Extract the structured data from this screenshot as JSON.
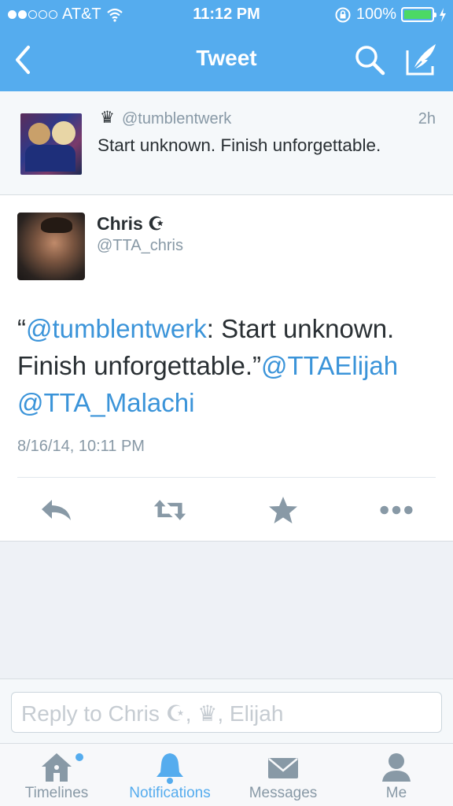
{
  "status_bar": {
    "carrier": "AT&T",
    "time": "11:12 PM",
    "battery": "100%",
    "signal_bars_filled": 2,
    "signal_bars_total": 5
  },
  "nav": {
    "title": "Tweet",
    "back_icon": "chevron-left-icon",
    "search_icon": "search-icon",
    "compose_icon": "compose-icon"
  },
  "original_tweet": {
    "crown": "♛",
    "handle": "@tumblentwerk",
    "time": "2h",
    "text": "Start unknown. Finish unforgettable."
  },
  "tweet": {
    "name": "Chris ☪",
    "username": "@TTA_chris",
    "body": {
      "open_quote": "“",
      "mention1": "@tumblentwerk",
      "text1": ": Start unknown. Finish unforgettable.”",
      "mention2": "@TTAElijah",
      "mention3": "@TTA_Malachi"
    },
    "date": "8/16/14, 10:11 PM",
    "actions": [
      "reply-icon",
      "retweet-icon",
      "favorite-icon",
      "more-icon"
    ]
  },
  "reply": {
    "placeholder": "Reply to Chris ☪, ♛, Elijah"
  },
  "tabs": [
    {
      "label": "Timelines",
      "icon": "home-icon"
    },
    {
      "label": "Notifications",
      "icon": "bell-icon",
      "active": true
    },
    {
      "label": "Messages",
      "icon": "envelope-icon"
    },
    {
      "label": "Me",
      "icon": "person-icon"
    }
  ],
  "colors": {
    "accent": "#55acee",
    "link": "#3b94d9",
    "text": "#292f33",
    "muted": "#8899a6",
    "battery": "#4cd964"
  }
}
